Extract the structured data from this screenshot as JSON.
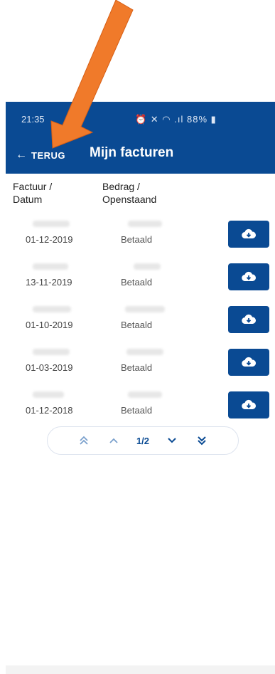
{
  "status_bar": {
    "time": "21:35",
    "icons": "⏰ ✕ ◠ .ıl 88% ▮"
  },
  "app_bar": {
    "back_label": "TERUG",
    "title": "Mijn facturen"
  },
  "columns": {
    "col1_line1": "Factuur /",
    "col1_line2": "Datum",
    "col2_line1": "Bedrag /",
    "col2_line2": "Openstaand"
  },
  "invoices": [
    {
      "date": "01-12-2019",
      "status": "Betaald"
    },
    {
      "date": "13-11-2019",
      "status": "Betaald"
    },
    {
      "date": "01-10-2019",
      "status": "Betaald"
    },
    {
      "date": "01-03-2019",
      "status": "Betaald"
    },
    {
      "date": "01-12-2018",
      "status": "Betaald"
    }
  ],
  "pagination": {
    "page_indicator": "1/2"
  },
  "colors": {
    "brand": "#0a4a93",
    "annotation_arrow": "#f07a2a"
  },
  "icons": [
    "back-arrow-icon",
    "cloud-download-icon",
    "double-chevron-up-icon",
    "chevron-up-icon",
    "chevron-down-icon",
    "double-chevron-down-icon"
  ]
}
